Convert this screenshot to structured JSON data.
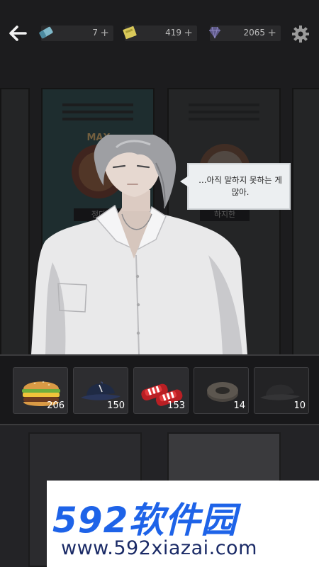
{
  "topbar": {
    "resources": [
      {
        "icon": "eraser-icon",
        "value": "7",
        "plus": "+"
      },
      {
        "icon": "ticket-icon",
        "value": "419",
        "plus": "+"
      },
      {
        "icon": "gem-icon",
        "value": "2065",
        "plus": "+"
      }
    ]
  },
  "scene": {
    "lockers": [
      {
        "nameplate": "정다",
        "badge": "MAX"
      },
      {
        "nameplate": "하지한"
      }
    ]
  },
  "dialogue": {
    "text": "…아직 말하지 못하는 게 많아."
  },
  "items": [
    {
      "name": "burger-item",
      "count": "206"
    },
    {
      "name": "cap-item",
      "count": "150"
    },
    {
      "name": "slippers-item",
      "count": "153"
    },
    {
      "name": "locked-item-1",
      "count": "14"
    },
    {
      "name": "locked-item-2",
      "count": "10"
    }
  ],
  "watermark": {
    "brand": "592软件园",
    "url": "www.592xiazai.com"
  },
  "colors": {
    "background": "#1a1a1c",
    "watermark_blue": "#1e63e8",
    "bubble_bg": "#eceff1"
  }
}
